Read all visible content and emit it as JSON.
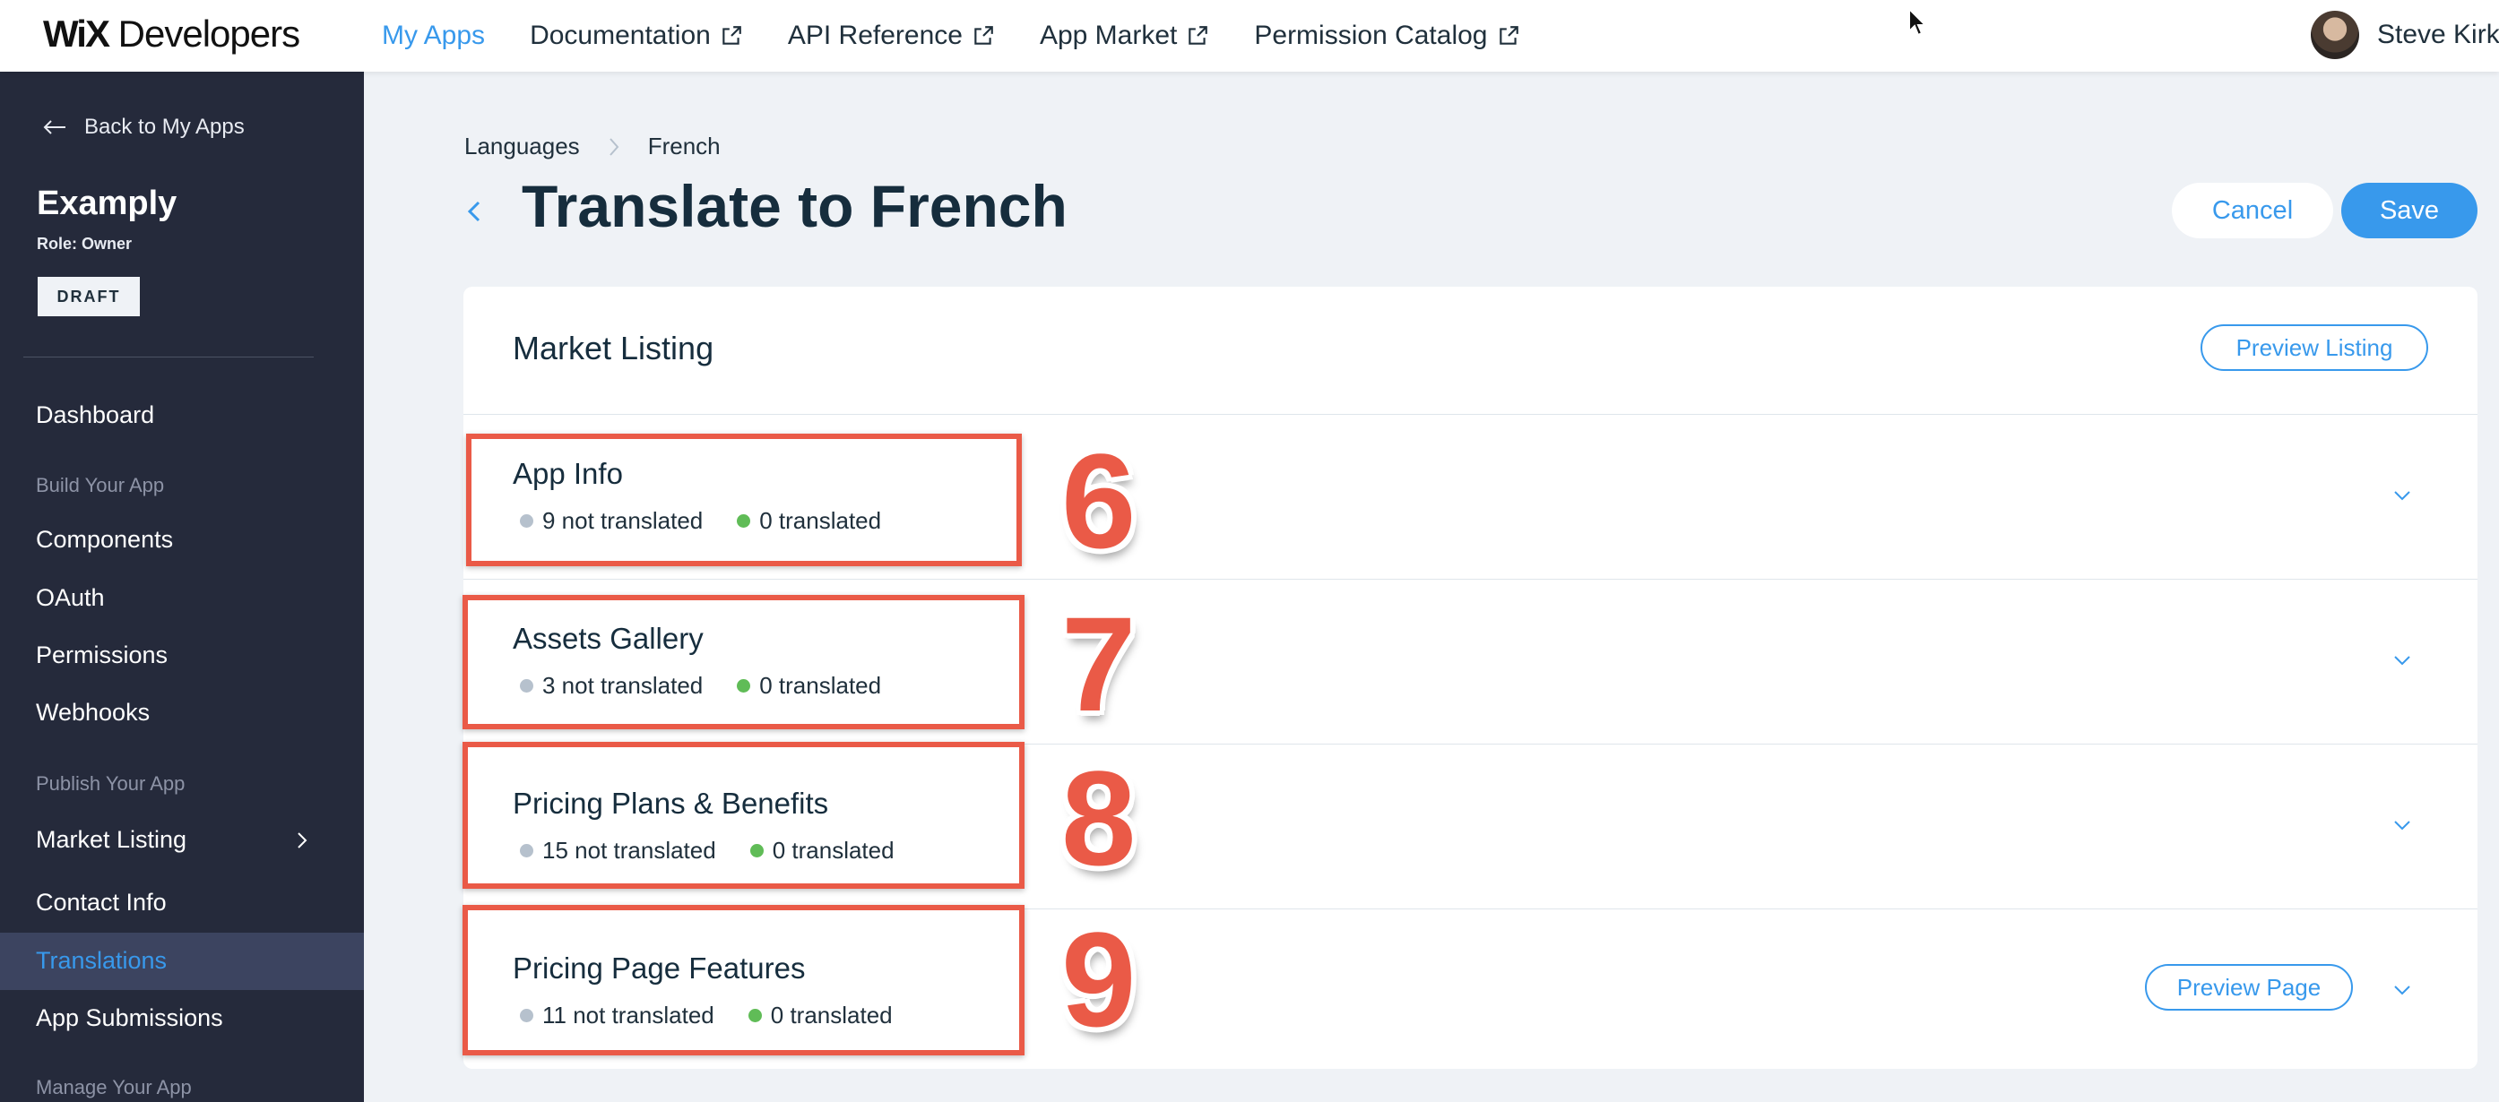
{
  "topbar": {
    "logo_mark": "WiX",
    "logo_text": "Developers",
    "nav": [
      {
        "label": "My Apps",
        "active": true,
        "external": false
      },
      {
        "label": "Documentation",
        "active": false,
        "external": true
      },
      {
        "label": "API Reference",
        "active": false,
        "external": true
      },
      {
        "label": "App Market",
        "active": false,
        "external": true
      },
      {
        "label": "Permission Catalog",
        "active": false,
        "external": true
      }
    ],
    "user_name": "Steve Kirk"
  },
  "sidebar": {
    "back_label": "Back to My Apps",
    "app_name": "Examply",
    "role": "Role: Owner",
    "status_badge": "DRAFT",
    "items": {
      "dashboard": "Dashboard",
      "section_build": "Build Your App",
      "components": "Components",
      "oauth": "OAuth",
      "permissions": "Permissions",
      "webhooks": "Webhooks",
      "section_publish": "Publish Your App",
      "market_listing": "Market Listing",
      "contact_info": "Contact Info",
      "translations": "Translations",
      "app_submissions": "App Submissions",
      "section_manage": "Manage Your App"
    },
    "active_item": "Translations"
  },
  "main": {
    "breadcrumb": [
      "Languages",
      "French"
    ],
    "title": "Translate to French",
    "cancel_label": "Cancel",
    "save_label": "Save",
    "card": {
      "title": "Market Listing",
      "preview_listing_label": "Preview Listing",
      "sections": [
        {
          "title": "App Info",
          "not_translated": "9 not translated",
          "translated": "0 translated",
          "annotation": "6"
        },
        {
          "title": "Assets Gallery",
          "not_translated": "3 not translated",
          "translated": "0 translated",
          "annotation": "7"
        },
        {
          "title": "Pricing Plans & Benefits",
          "not_translated": "15 not translated",
          "translated": "0 translated",
          "annotation": "8"
        },
        {
          "title": "Pricing Page Features",
          "not_translated": "11 not translated",
          "translated": "0 translated",
          "annotation": "9",
          "preview_label": "Preview Page"
        }
      ]
    }
  },
  "colors": {
    "accent": "#3899ec",
    "sidebar_bg": "#252a3b",
    "annotation_red": "#ea5a47",
    "dot_not_translated": "#b6c1cd",
    "dot_translated": "#60bc57"
  }
}
